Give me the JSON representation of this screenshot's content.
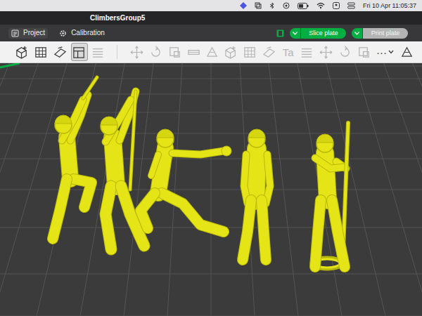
{
  "menubar": {
    "clock": "Fri 10 Apr  11:05:37"
  },
  "window": {
    "title": "ClimbersGroup5"
  },
  "tabs": [
    {
      "label": "Project",
      "selected": true
    },
    {
      "label": "Calibration",
      "selected": false
    }
  ],
  "actions": [
    {
      "label": "Slice plate",
      "disabled": false
    },
    {
      "label": "Print plate",
      "disabled": true
    }
  ],
  "toolbar": [
    {
      "kind": "icon",
      "enabled": true,
      "selected": false
    },
    {
      "kind": "icon",
      "enabled": true,
      "selected": false
    },
    {
      "kind": "icon",
      "enabled": true,
      "selected": false
    },
    {
      "kind": "icon",
      "enabled": true,
      "selected": true
    },
    {
      "kind": "icon",
      "enabled": false,
      "selected": false
    },
    {
      "kind": "icon",
      "enabled": false,
      "selected": false
    },
    {
      "kind": "icon",
      "enabled": false,
      "selected": false
    },
    {
      "kind": "icon",
      "enabled": false,
      "selected": false
    },
    {
      "kind": "icon",
      "enabled": false,
      "selected": false
    },
    {
      "kind": "icon",
      "enabled": false,
      "selected": false
    },
    {
      "kind": "icon",
      "enabled": false,
      "selected": false
    },
    {
      "kind": "icon",
      "enabled": false,
      "selected": false
    },
    {
      "kind": "icon",
      "enabled": false,
      "selected": false
    },
    {
      "kind": "text",
      "label": "Ta",
      "enabled": false,
      "selected": false
    },
    {
      "kind": "icon",
      "enabled": false,
      "selected": false
    },
    {
      "kind": "icon",
      "enabled": false,
      "selected": false
    },
    {
      "kind": "icon",
      "enabled": false,
      "selected": false
    },
    {
      "kind": "icon",
      "enabled": false,
      "selected": false
    },
    {
      "kind": "text",
      "label": "···",
      "enabled": true,
      "selected": false
    },
    {
      "kind": "icon",
      "enabled": true,
      "selected": false
    }
  ]
}
